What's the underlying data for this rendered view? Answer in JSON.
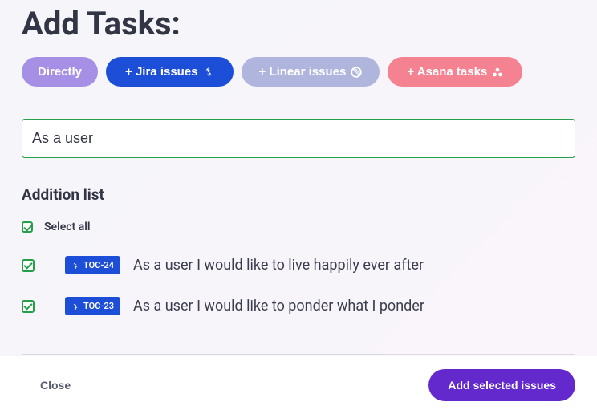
{
  "title": "Add Tasks:",
  "sources": {
    "directly": "Directly",
    "jira": "+ Jira issues",
    "linear": "+ Linear issues",
    "asana": "+ Asana tasks"
  },
  "search": {
    "value": "As a user"
  },
  "list": {
    "heading": "Addition list",
    "select_all": "Select all",
    "items": [
      {
        "key": "TOC-24",
        "title": "As a user I would like to live happily ever after",
        "checked": true
      },
      {
        "key": "TOC-23",
        "title": "As a user I would like to ponder what I ponder",
        "checked": true
      }
    ]
  },
  "footer": {
    "close": "Close",
    "submit": "Add selected issues"
  }
}
